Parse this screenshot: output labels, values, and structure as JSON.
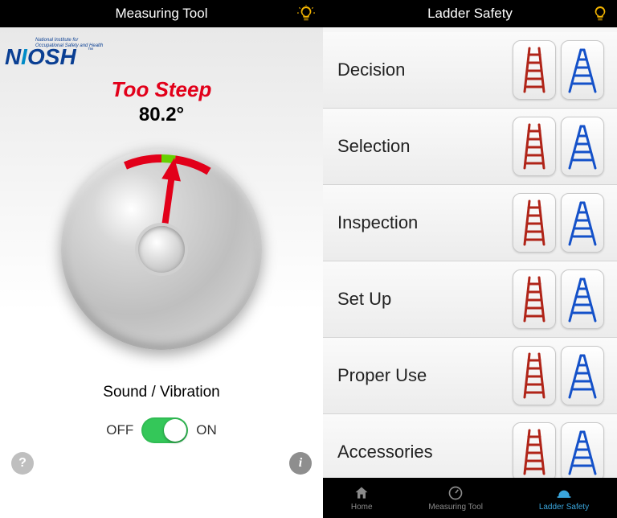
{
  "left": {
    "title": "Measuring Tool",
    "logo_tagline_line1": "National Institute for",
    "logo_tagline_line2": "Occupational Safety and Health",
    "status": "Too Steep",
    "angle": "80.2°",
    "sound_vibration_label": "Sound / Vibration",
    "toggle_off": "OFF",
    "toggle_on": "ON",
    "toggle_state": true,
    "status_color": "#e2001a"
  },
  "right": {
    "title": "Ladder Safety",
    "menu": [
      {
        "label": "Decision"
      },
      {
        "label": "Selection"
      },
      {
        "label": "Inspection"
      },
      {
        "label": "Set Up"
      },
      {
        "label": "Proper Use"
      },
      {
        "label": "Accessories"
      }
    ],
    "tabs": {
      "home": "Home",
      "measuring": "Measuring Tool",
      "safety": "Ladder Safety"
    }
  }
}
